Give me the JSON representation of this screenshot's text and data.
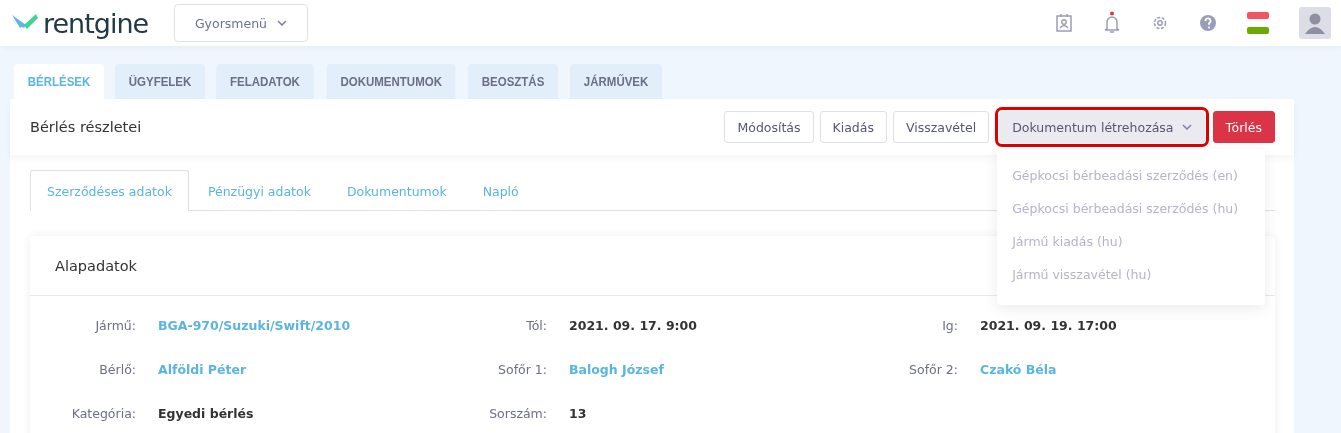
{
  "header": {
    "logo": "rentgine",
    "quick_menu": {
      "label": "Gyorsmenü"
    },
    "notifications": {
      "has_new": true
    }
  },
  "tabs": [
    {
      "label": "BÉRLÉSEK",
      "selected": true
    },
    {
      "label": "ÜGYFELEK",
      "selected": false
    },
    {
      "label": "FELADATOK",
      "selected": false
    },
    {
      "label": "DOKUMENTUMOK",
      "selected": false
    },
    {
      "label": "BEOSZTÁS",
      "selected": false
    },
    {
      "label": "JÁRMŰVEK",
      "selected": false
    }
  ],
  "panel": {
    "title": "Bérlés részletei",
    "actions": [
      {
        "label": "Módosítás",
        "kind": "default"
      },
      {
        "label": "Kiadás",
        "kind": "default"
      },
      {
        "label": "Visszavétel",
        "kind": "default"
      },
      {
        "label": "Dokumentum létrehozása",
        "kind": "dropdown",
        "expanded": true,
        "highlighted": true,
        "menu": [
          "Gépkocsi bérbeadási szerződés (en)",
          "Gépkocsi bérbeadási szerződés (hu)",
          "Jármű kiadás (hu)",
          "Jármű visszavétel (hu)"
        ]
      },
      {
        "label": "Törlés",
        "kind": "danger"
      }
    ],
    "subtabs": [
      {
        "label": "Szerződéses adatok",
        "selected": true
      },
      {
        "label": "Pénzügyi adatok",
        "selected": false
      },
      {
        "label": "Dokumentumok",
        "selected": false
      },
      {
        "label": "Napló",
        "selected": false
      }
    ],
    "card": {
      "title": "Alapadatok",
      "rows": [
        [
          {
            "label": "Jármű:",
            "value": "BGA-970/Suzuki/Swift/2010",
            "kind": "link"
          },
          {
            "label": "Tól:",
            "value": "2021. 09. 17. 9:00",
            "kind": "text"
          },
          {
            "label": "Ig:",
            "value": "2021. 09. 19. 17:00",
            "kind": "text"
          }
        ],
        [
          {
            "label": "Bérlő:",
            "value": "Alföldi Péter",
            "kind": "link"
          },
          {
            "label": "Sofőr 1:",
            "value": "Balogh József",
            "kind": "link"
          },
          {
            "label": "Sofőr 2:",
            "value": "Czakó Béla",
            "kind": "link"
          }
        ],
        [
          {
            "label": "Kategória:",
            "value": "Egyedi bérlés",
            "kind": "text"
          },
          {
            "label": "Sorszám:",
            "value": "13",
            "kind": "text"
          }
        ]
      ]
    }
  }
}
